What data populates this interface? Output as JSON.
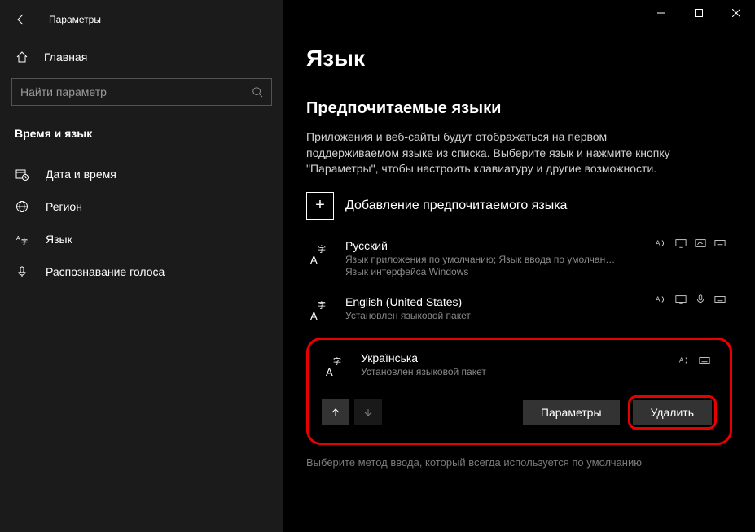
{
  "app_title": "Параметры",
  "sidebar": {
    "home": "Главная",
    "search_placeholder": "Найти параметр",
    "category": "Время и язык",
    "items": [
      {
        "label": "Дата и время"
      },
      {
        "label": "Регион"
      },
      {
        "label": "Язык"
      },
      {
        "label": "Распознавание голоса"
      }
    ]
  },
  "main": {
    "title": "Язык",
    "section_heading": "Предпочитаемые языки",
    "description": "Приложения и веб-сайты будут отображаться на первом поддерживаемом языке из списка. Выберите язык и нажмите кнопку \"Параметры\", чтобы настроить клавиатуру и другие возможности.",
    "add_label": "Добавление предпочитаемого языка",
    "languages": [
      {
        "name": "Русский",
        "sub1": "Язык приложения по умолчанию; Язык ввода по умолчан…",
        "sub2": "Язык интерфейса Windows"
      },
      {
        "name": "English (United States)",
        "sub1": "Установлен языковой пакет"
      }
    ],
    "selected": {
      "name": "Українська",
      "sub1": "Установлен языковой пакет",
      "options_btn": "Параметры",
      "delete_btn": "Удалить"
    },
    "footer": "Выберите метод ввода, который всегда используется по умолчанию"
  }
}
